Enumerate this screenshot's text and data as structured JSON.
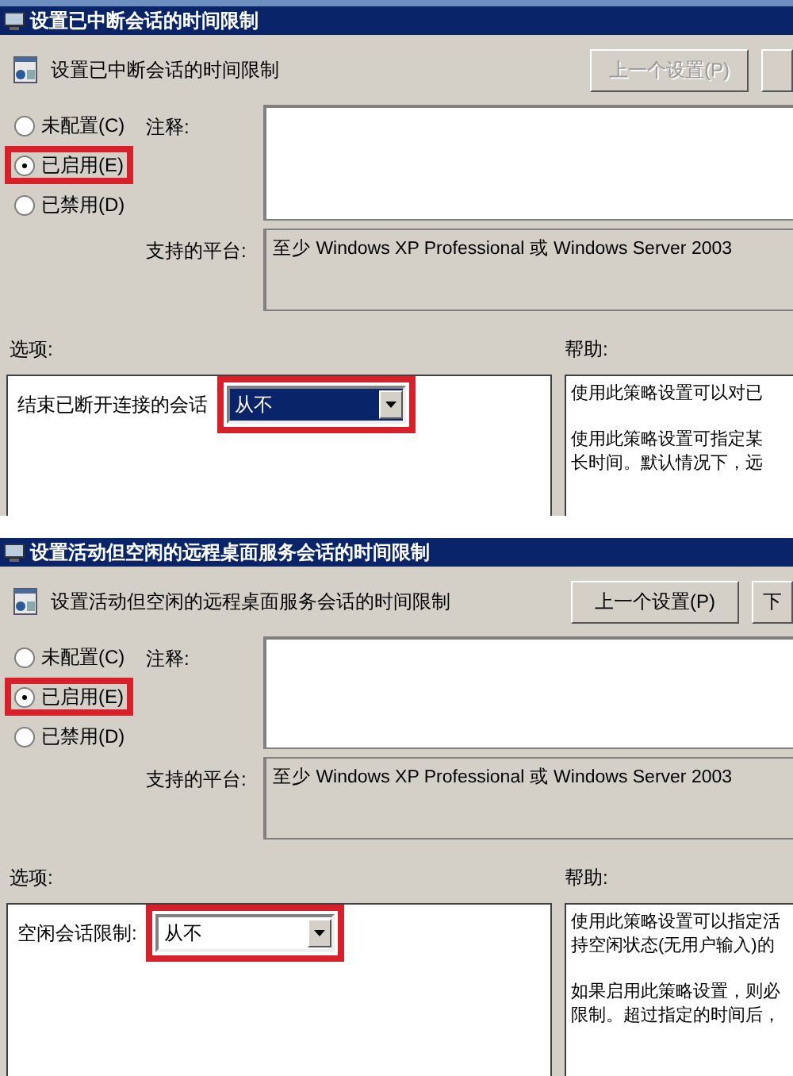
{
  "dialogs": [
    {
      "title": "设置已中断会话的时间限制",
      "heading": "设置已中断会话的时间限制",
      "prev_button": {
        "label": "上一个设置(P)",
        "disabled": true
      },
      "radios": [
        {
          "label": "未配置(C)",
          "selected": false,
          "highlighted": false
        },
        {
          "label": "已启用(E)",
          "selected": true,
          "highlighted": true
        },
        {
          "label": "已禁用(D)",
          "selected": false,
          "highlighted": false
        }
      ],
      "comment_label": "注释:",
      "platform_label": "支持的平台:",
      "platform": "至少 Windows XP Professional 或 Windows Server 2003",
      "options_label": "选项:",
      "help_label": "帮助:",
      "option": {
        "label": "结束已断开连接的会话",
        "value": "从不",
        "focused": true,
        "highlighted": true
      },
      "help_paragraphs": [
        [
          "使用此策略设置可以对已"
        ],
        [
          "使用此策略设置可指定某",
          "长时间。默认情况下，远"
        ]
      ]
    },
    {
      "title": "设置活动但空闲的远程桌面服务会话的时间限制",
      "heading": "设置活动但空闲的远程桌面服务会话的时间限制",
      "prev_button": {
        "label": "上一个设置(P)",
        "disabled": false
      },
      "next_button": {
        "label": "下"
      },
      "radios": [
        {
          "label": "未配置(C)",
          "selected": false,
          "highlighted": false
        },
        {
          "label": "已启用(E)",
          "selected": true,
          "highlighted": true
        },
        {
          "label": "已禁用(D)",
          "selected": false,
          "highlighted": false
        }
      ],
      "comment_label": "注释:",
      "platform_label": "支持的平台:",
      "platform": "至少 Windows XP Professional 或 Windows Server 2003",
      "options_label": "选项:",
      "help_label": "帮助:",
      "option": {
        "label": "空闲会话限制:",
        "value": "从不",
        "focused": false,
        "highlighted": true
      },
      "help_paragraphs": [
        [
          "使用此策略设置可以指定活",
          "持空闲状态(无用户输入)的"
        ],
        [
          "如果启用此策略设置，则必",
          "限制。超过指定的时间后，"
        ]
      ]
    }
  ]
}
